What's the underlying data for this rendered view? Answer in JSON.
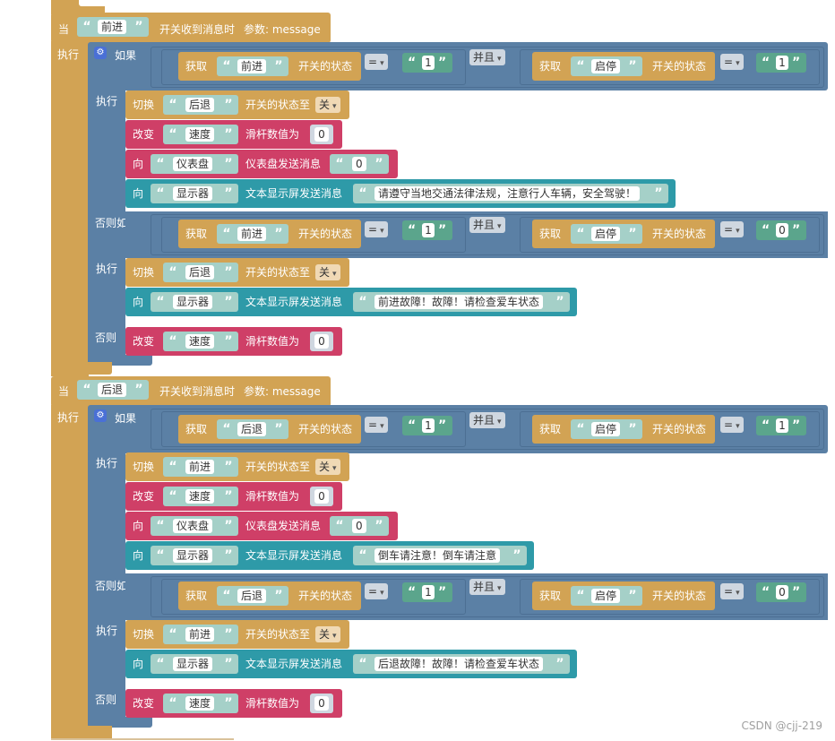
{
  "labels": {
    "when": "当",
    "do": "执行",
    "if": "如果",
    "elseif": "否则如果",
    "else": "否则",
    "get": "获取",
    "and": "并且",
    "eq": "=",
    "switch": "切换",
    "change": "改变",
    "to": "向",
    "switch_state": "开关的状态",
    "switch_state_to": "开关的状态至",
    "slider_value": "滑杆数值为",
    "gauge_send": "仪表盘发送消息",
    "display_send": "文本显示屏发送消息",
    "on_message": "开关收到消息时",
    "param": "参数: message",
    "off": "关",
    "quote_open": "“",
    "quote_close": "”"
  },
  "names": {
    "forward": "前进",
    "backward": "后退",
    "startstop": "启停",
    "speed": "速度",
    "gauge": "仪表盘",
    "display": "显示器"
  },
  "values": {
    "one": "1",
    "zero": "0"
  },
  "messages": {
    "obey": "请遵守当地交通法律法规，注意行人车辆，安全驾驶！",
    "fwd_fault": "前进故障！故障！请检查爱车状态",
    "reverse_warn": "倒车请注意！倒车请注意",
    "bwd_fault": "后退故障！故障！请检查爱车状态"
  },
  "watermark": "CSDN @cjj-219",
  "colors": {
    "event": "#d2a354",
    "logic": "#5b80a5",
    "text": "#2e9aa8",
    "change": "#cf3f67",
    "string": "#a5d0c8",
    "number_bool": "#5ba58c"
  }
}
